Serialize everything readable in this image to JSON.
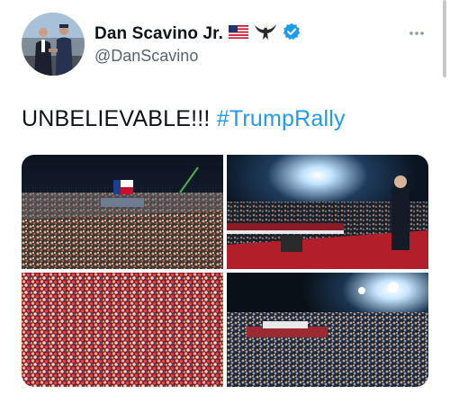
{
  "author": {
    "name": "Dan Scavino Jr.",
    "handle": "@DanScavino",
    "flag_emoji": "🇺🇸",
    "badge_icon": "verified-badge-icon",
    "verified_color": "#1d9bf0"
  },
  "tweet": {
    "text": "UNBELIEVABLE!!!",
    "hashtag": "#TrumpRally",
    "hashtag_color": "#1d9bf0"
  },
  "media": {
    "count": 4
  }
}
